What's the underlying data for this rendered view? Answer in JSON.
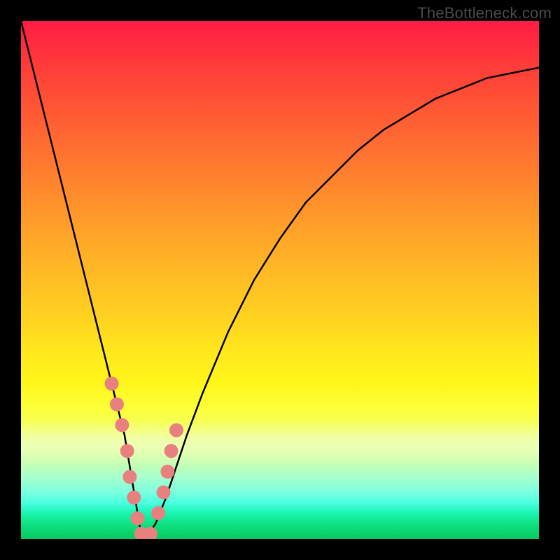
{
  "watermark": "TheBottleneck.com",
  "chart_data": {
    "type": "line",
    "title": "",
    "xlabel": "",
    "ylabel": "",
    "xlim": [
      0,
      100
    ],
    "ylim": [
      0,
      100
    ],
    "grid": false,
    "legend": false,
    "series": [
      {
        "name": "bottleneck-curve",
        "x": [
          0,
          4,
          8,
          12,
          14,
          16,
          18,
          20,
          21,
          22,
          23,
          24,
          26,
          28,
          30,
          32,
          35,
          40,
          45,
          50,
          55,
          60,
          65,
          70,
          75,
          80,
          85,
          90,
          95,
          100
        ],
        "values": [
          100,
          84,
          68,
          52,
          44,
          36,
          28,
          20,
          14,
          8,
          2,
          0,
          3,
          8,
          14,
          20,
          28,
          40,
          50,
          58,
          65,
          70,
          75,
          79,
          82,
          85,
          87,
          89,
          90,
          91
        ]
      }
    ],
    "markers": {
      "name": "highlight-dots",
      "color": "#e98080",
      "x": [
        17.5,
        18.5,
        19.5,
        20.5,
        21.0,
        21.8,
        22.5,
        23.2,
        24.0,
        25.0,
        26.5,
        27.5,
        28.3,
        29.0,
        30.0
      ],
      "values": [
        30,
        26,
        22,
        17,
        12,
        8,
        4,
        1,
        0,
        1,
        5,
        9,
        13,
        17,
        21
      ]
    },
    "colors": {
      "curve": "#000000",
      "marker": "#e98080",
      "gradient_top": "#ff1c44",
      "gradient_bottom": "#06c95f"
    }
  }
}
